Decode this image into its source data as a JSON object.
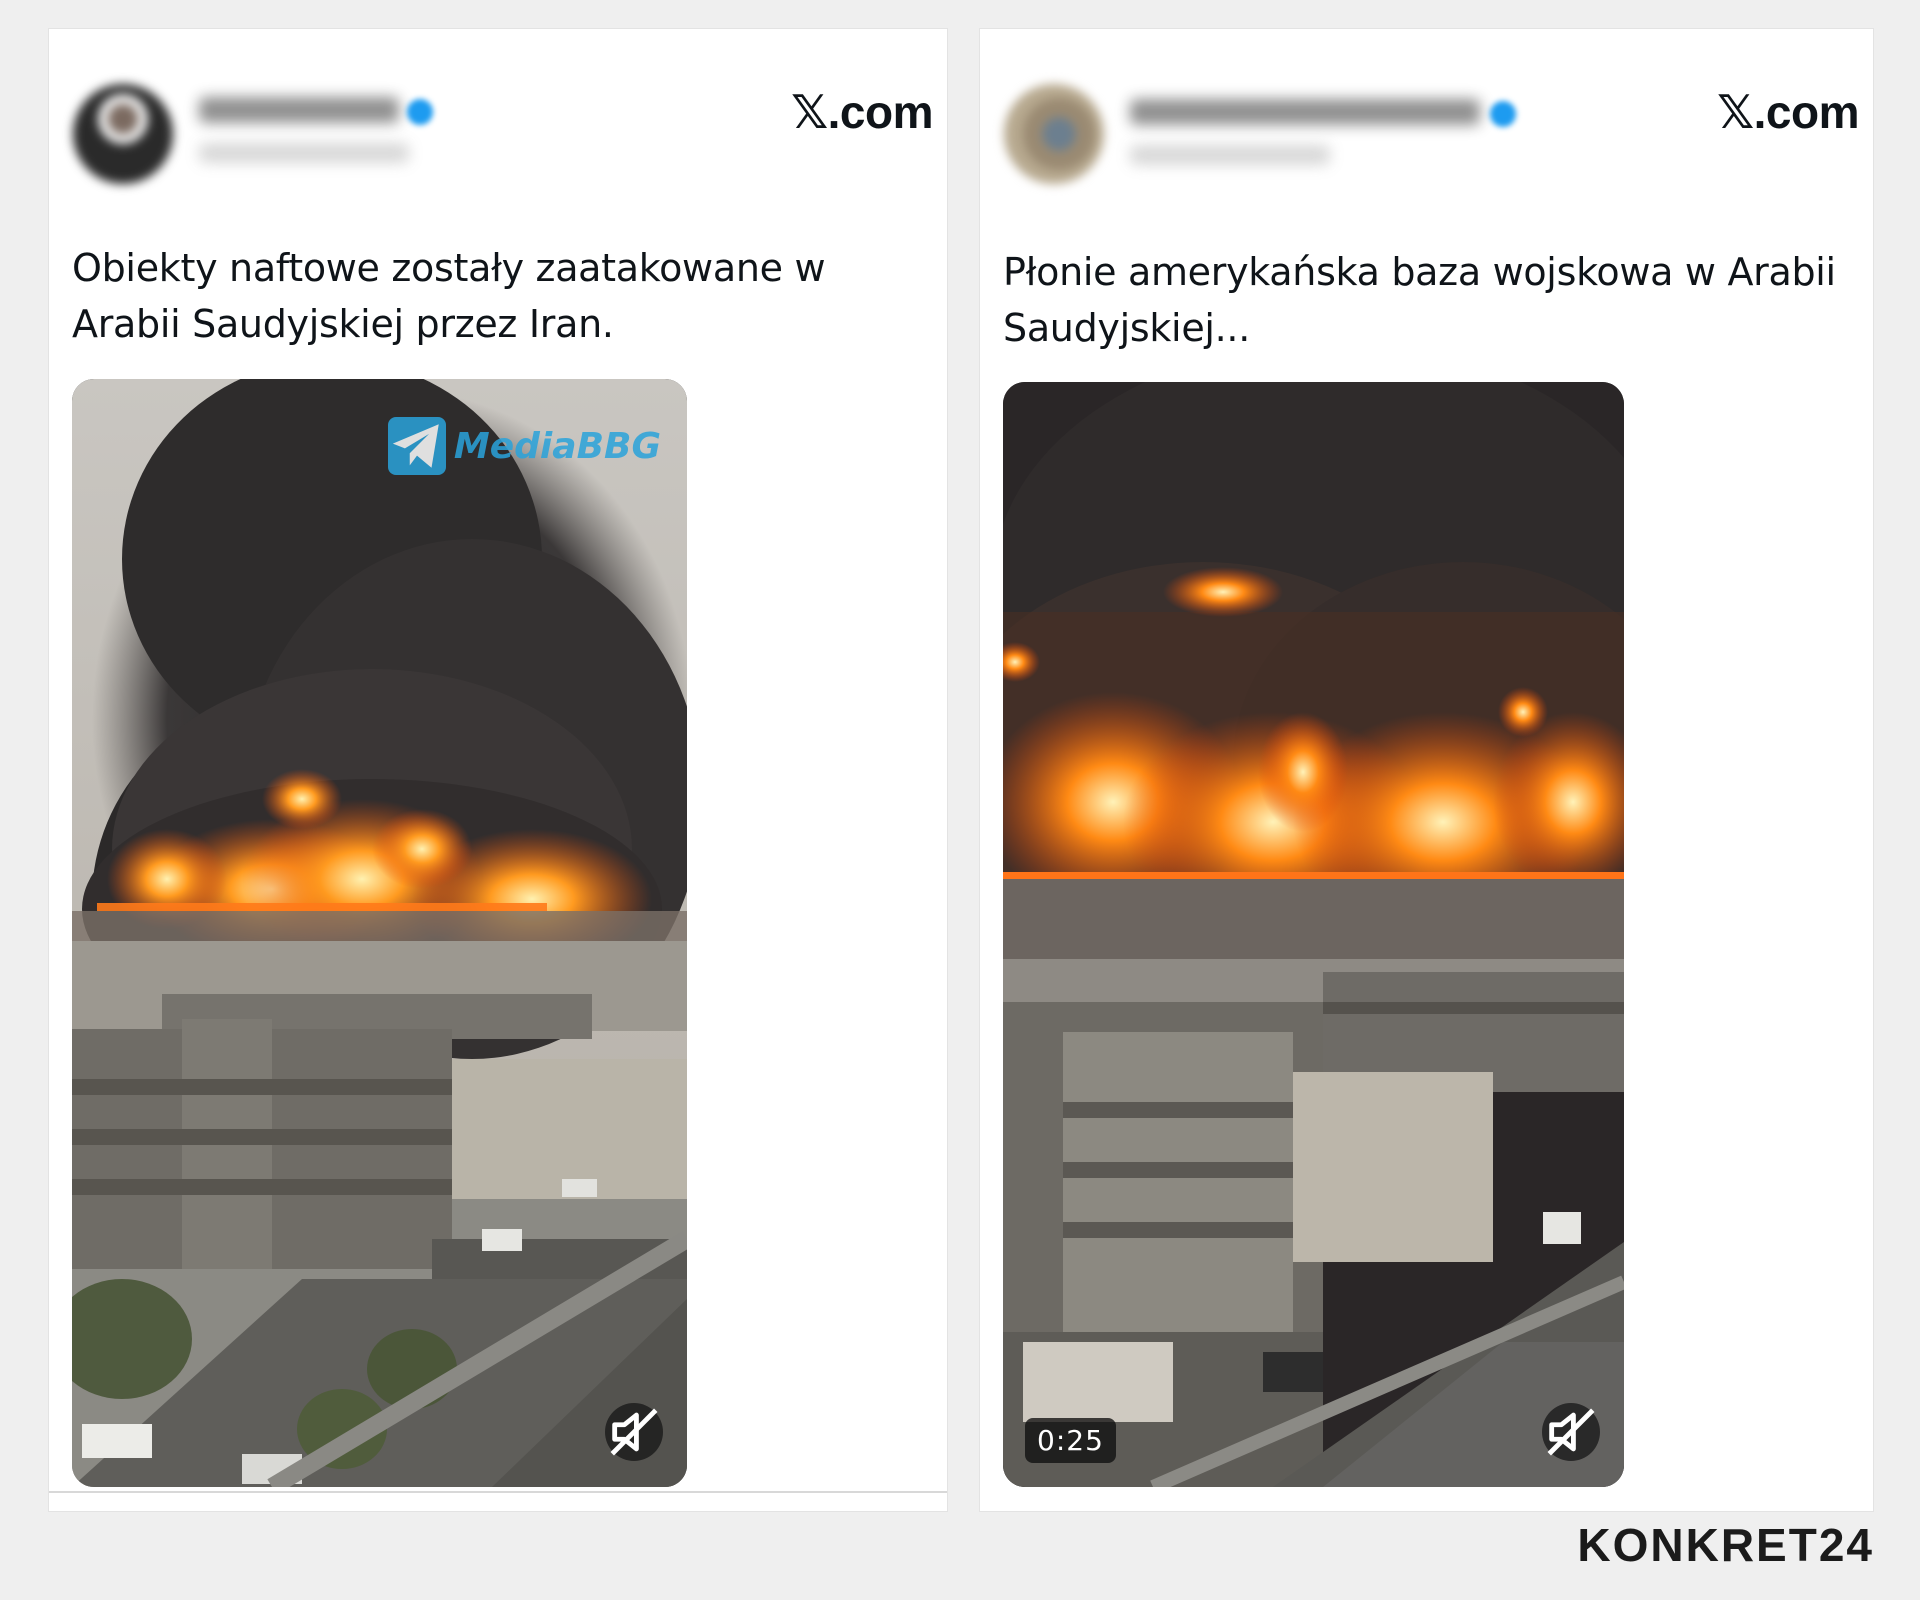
{
  "posts": [
    {
      "site_label": "𝕏.com",
      "text": "Obiekty naftowe zostały zaatakowane w Arabii Saudyjskiej przez Iran.",
      "watermark": "MediaBBG",
      "icons": {
        "avatar": "avatar-blurred",
        "verified": "verified-badge-icon",
        "mute": "speaker-muted-icon",
        "watermark": "telegram-icon"
      }
    },
    {
      "site_label": "𝕏.com",
      "text": "Płonie amerykańska baza wojskowa w Arabii Saudyjskiej...",
      "duration": "0:25",
      "icons": {
        "avatar": "avatar-blurred",
        "verified": "verified-badge-icon",
        "mute": "speaker-muted-icon"
      }
    }
  ],
  "brand": "KONKRET24",
  "colors": {
    "background": "#efefef",
    "card": "#ffffff",
    "text": "#0f1419",
    "verified": "#1d9bf0",
    "fire": "#ff6a00",
    "smoke": "#2d2b2c"
  }
}
